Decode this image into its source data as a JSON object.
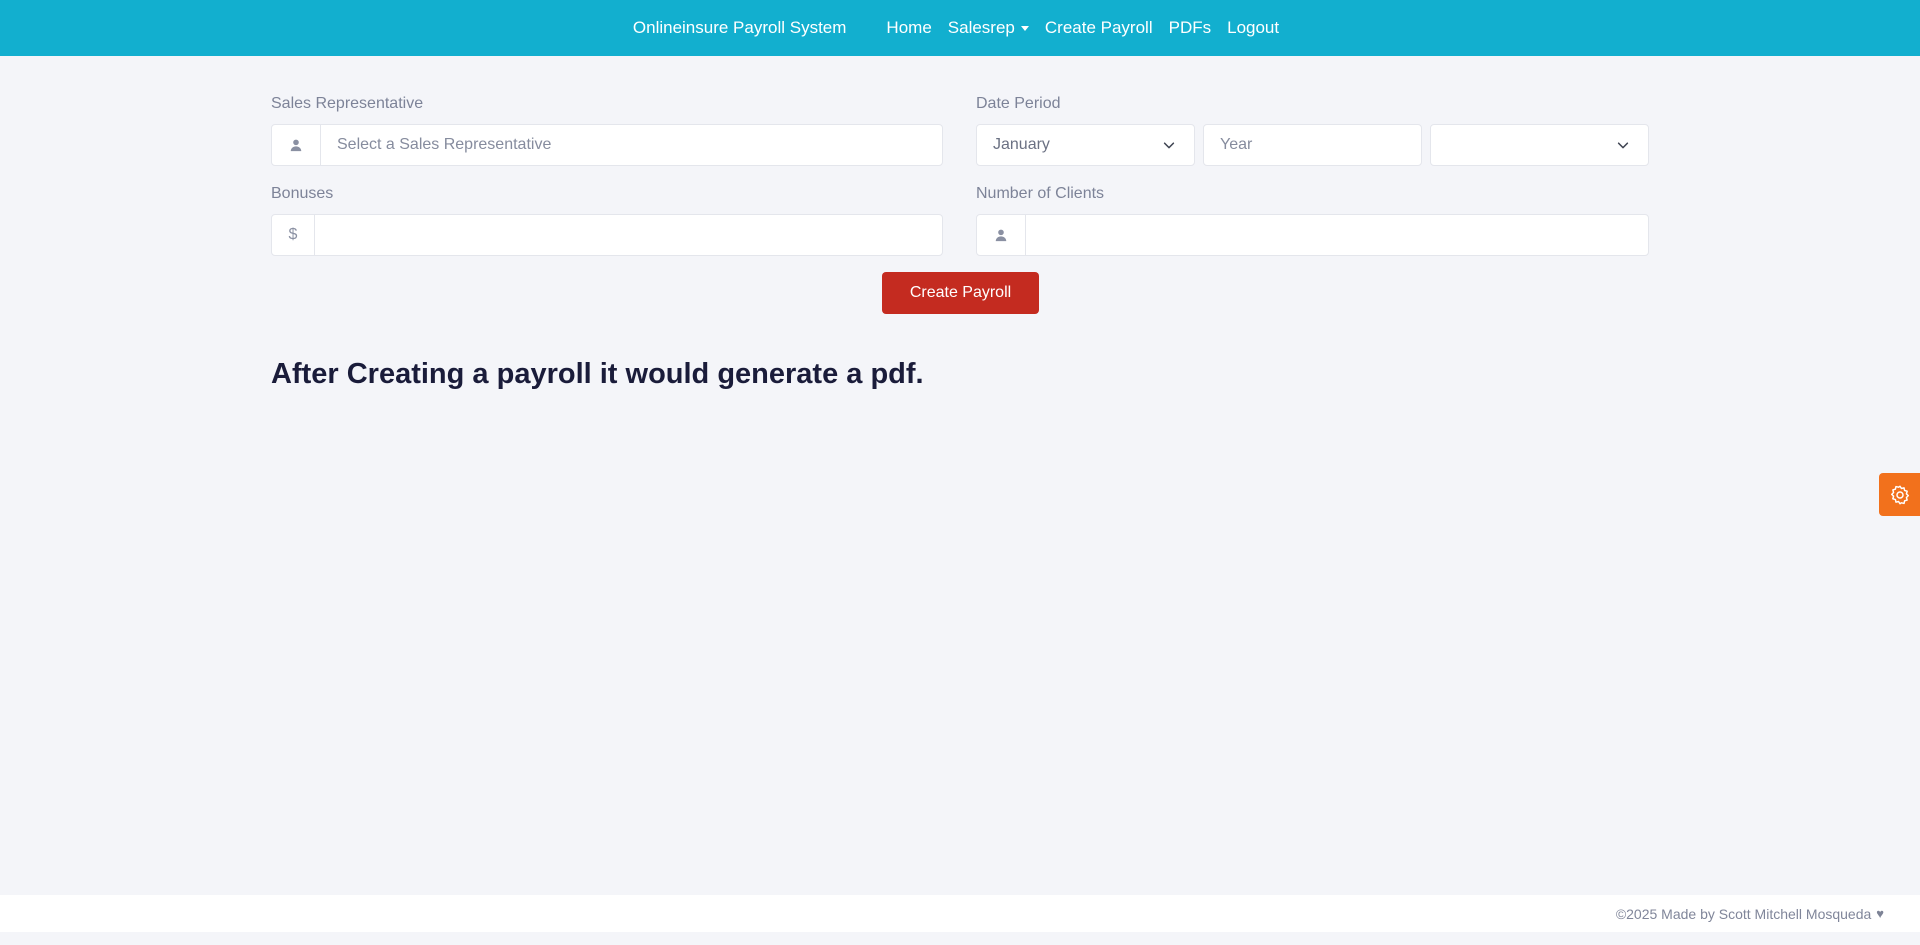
{
  "navbar": {
    "brand": "Onlineinsure Payroll System",
    "links": [
      "Home",
      "Salesrep",
      "Create Payroll",
      "PDFs",
      "Logout"
    ]
  },
  "form": {
    "sales_rep": {
      "label": "Sales Representative",
      "placeholder": "Select a Sales Representative",
      "icon": "user-icon"
    },
    "date_period": {
      "label": "Date Period",
      "month_value": "January",
      "year_placeholder": "Year",
      "third_select_value": ""
    },
    "bonuses": {
      "label": "Bonuses",
      "prefix": "$",
      "value": ""
    },
    "clients": {
      "label": "Number of Clients",
      "icon": "user-icon",
      "value": ""
    },
    "submit_label": "Create Payroll"
  },
  "main": {
    "heading": "After Creating a payroll it would generate a pdf."
  },
  "footer": {
    "text": "©2025 Made by Scott Mitchell Mosqueda",
    "heart": "♥"
  },
  "colors": {
    "navbar": "#12afcf",
    "primary_button": "#c42b20",
    "settings_button": "#f2711c",
    "background": "#f4f5f9"
  }
}
